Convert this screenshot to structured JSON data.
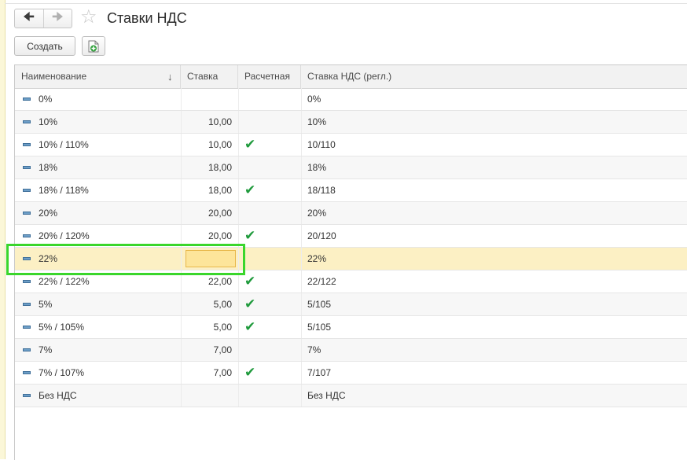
{
  "window": {
    "title": "Ставки НДС",
    "back_icon": "arrow-left-icon",
    "forward_icon": "arrow-right-icon",
    "favorite_icon": "star-icon"
  },
  "toolbar": {
    "create_label": "Создать",
    "copy_icon": "document-add-icon"
  },
  "table": {
    "columns": {
      "name": "Наименование",
      "sort_indicator": "↓",
      "rate": "Ставка",
      "calculated": "Расчетная",
      "reg_rate": "Ставка НДС (регл.)"
    },
    "check_glyph": "✔",
    "rows": [
      {
        "name": "0%",
        "rate": "",
        "calculated": false,
        "reg_rate": "0%"
      },
      {
        "name": "10%",
        "rate": "10,00",
        "calculated": false,
        "reg_rate": "10%"
      },
      {
        "name": "10% / 110%",
        "rate": "10,00",
        "calculated": true,
        "reg_rate": "10/110"
      },
      {
        "name": "18%",
        "rate": "18,00",
        "calculated": false,
        "reg_rate": "18%"
      },
      {
        "name": "18% / 118%",
        "rate": "18,00",
        "calculated": true,
        "reg_rate": "18/118"
      },
      {
        "name": "20%",
        "rate": "20,00",
        "calculated": false,
        "reg_rate": "20%"
      },
      {
        "name": "20% / 120%",
        "rate": "20,00",
        "calculated": true,
        "reg_rate": "20/120"
      },
      {
        "name": "22%",
        "rate": "",
        "calculated": false,
        "reg_rate": "22%",
        "selected": true
      },
      {
        "name": "22% / 122%",
        "rate": "22,00",
        "calculated": true,
        "reg_rate": "22/122"
      },
      {
        "name": "5%",
        "rate": "5,00",
        "calculated": true,
        "reg_rate": "5/105"
      },
      {
        "name": "5% / 105%",
        "rate": "5,00",
        "calculated": true,
        "reg_rate": "5/105"
      },
      {
        "name": "7%",
        "rate": "7,00",
        "calculated": false,
        "reg_rate": "7%"
      },
      {
        "name": "7% / 107%",
        "rate": "7,00",
        "calculated": true,
        "reg_rate": "7/107"
      },
      {
        "name": "Без НДС",
        "rate": "",
        "calculated": false,
        "reg_rate": "Без НДС"
      }
    ]
  },
  "colors": {
    "selection_row": "#fcf0c4",
    "annotation_box": "#3ad62c",
    "check": "#1f9a3c"
  }
}
